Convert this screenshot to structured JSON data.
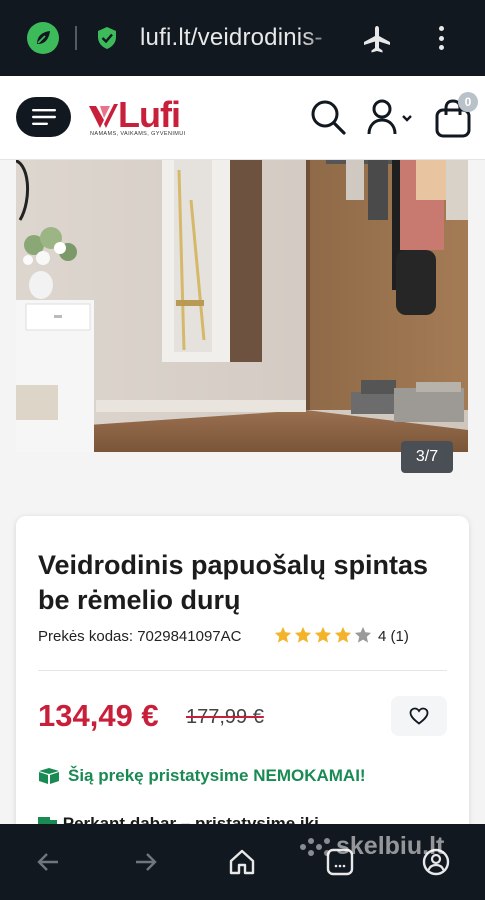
{
  "browser": {
    "url": "lufi.lt/veidrodinis-",
    "icons": [
      "leaf-icon",
      "lock-shield-icon",
      "airplane-icon",
      "more-vert-icon"
    ]
  },
  "header": {
    "logo_text": "Lufi",
    "logo_tagline": "NAMAMS, VAIKAMS, GYVENIMUI",
    "cart_count": "0"
  },
  "gallery": {
    "counter": "3/7",
    "current": 3,
    "total": 7
  },
  "product": {
    "title": "Veidrodinis papuošalų spintas be rėmelio durų",
    "sku_label": "Prekės kodas: 7029841097AC",
    "rating_value": 4,
    "rating_text": "4 (1)",
    "price": "134,49 €",
    "old_price": "177,99 €",
    "shipping_text": "Šią prekę pristatysime NEMOKAMAI!",
    "second_line": "Perkant dabar – pristatysime iki "
  },
  "colors": {
    "brand_red": "#c8203a",
    "shipping_green": "#1a8a53",
    "dark_bar": "#121820"
  },
  "watermark": "skelbiu.lt"
}
